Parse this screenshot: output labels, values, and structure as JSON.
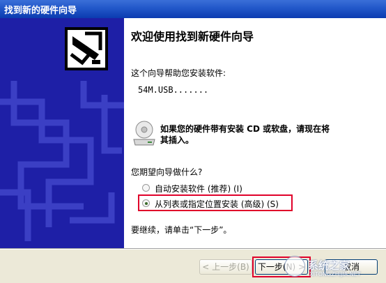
{
  "window": {
    "title": "找到新的硬件向导"
  },
  "wizard": {
    "heading": "欢迎使用找到新硬件向导",
    "intro": "这个向导帮助您安装软件:",
    "device_name": "54M.USB.......",
    "cd_hint_line1": "如果您的硬件带有安装 CD 或软盘，请现在将",
    "cd_hint_line2": "其插入。",
    "question": "您期望向导做什么?",
    "options": [
      {
        "label": "自动安装软件 (推荐) (I)",
        "selected": false
      },
      {
        "label": "从列表或指定位置安装 (高级) (S)",
        "selected": true
      }
    ],
    "continue_text": "要继续，请单击“下一步”。"
  },
  "buttons": {
    "back": "< 上一步(B)",
    "next": "下一步(N) >",
    "cancel": "取消"
  },
  "watermark": {
    "text": "系统之家",
    "sub": "XITONGZHIJIA.NET"
  },
  "colors": {
    "banner": "#1e1fa6",
    "titlebar": "#2257c9",
    "highlight": "#e0002a",
    "buttonbar": "#ece9d8"
  },
  "icons": [
    "hardware-wizard-icon",
    "cd-drive-icon",
    "radio-icon"
  ]
}
